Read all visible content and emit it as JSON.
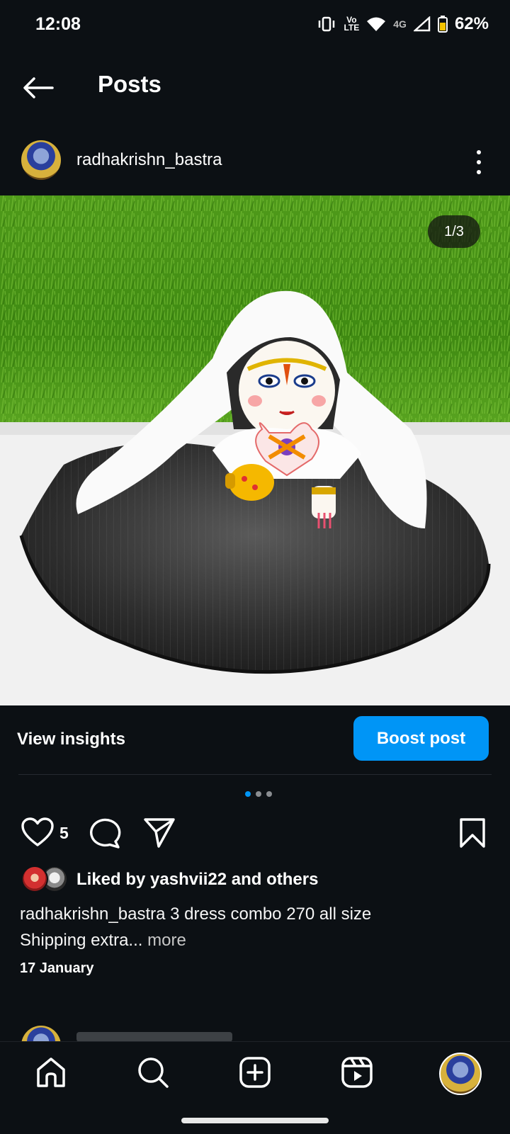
{
  "status_bar": {
    "time": "12:08",
    "volte_top": "Vo",
    "volte_bottom": "LTE",
    "network": "4G",
    "battery": "62%"
  },
  "header": {
    "title": "Posts",
    "back_icon": "back-arrow-icon"
  },
  "post": {
    "username": "radhakrishn_bastra",
    "image_counter": "1/3",
    "like_count": "5",
    "liked_by": "Liked by yashvii22 and others",
    "caption_user": "radhakrishn_bastra",
    "caption_text": " 3 dress combo 270 all size",
    "caption_line2": "Shipping extra...",
    "caption_more": " more",
    "date": "17 January",
    "carousel": {
      "count": 3,
      "active": 1
    }
  },
  "insights": {
    "view_label": "View insights",
    "boost_label": "Boost post"
  },
  "colors": {
    "background": "#0c1014",
    "accent": "#0095f6"
  },
  "bottom_nav": {
    "items": [
      "home-icon",
      "search-icon",
      "create-icon",
      "reels-icon",
      "profile-avatar"
    ]
  }
}
